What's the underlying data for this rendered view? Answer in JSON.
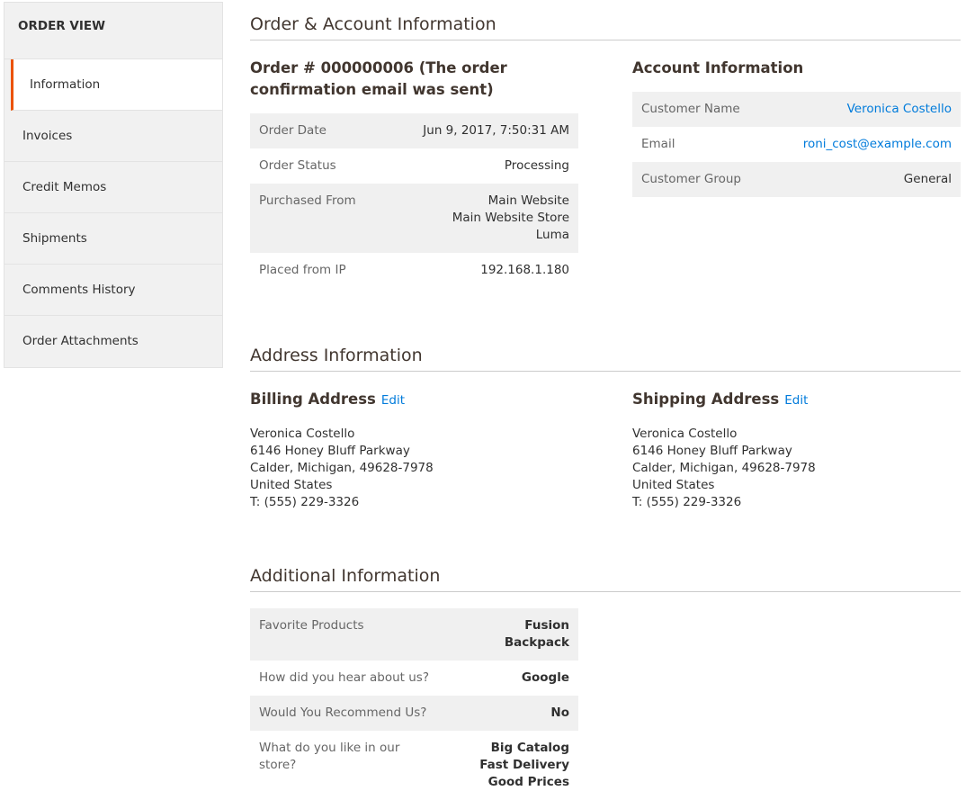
{
  "sidebar": {
    "title": "ORDER VIEW",
    "items": [
      "Information",
      "Invoices",
      "Credit Memos",
      "Shipments",
      "Comments History",
      "Order Attachments"
    ]
  },
  "order_account": {
    "title": "Order & Account Information",
    "order_heading": "Order # 000000006 (The order confirmation email was sent)",
    "order_rows": [
      {
        "label": "Order Date",
        "value": [
          "Jun 9, 2017, 7:50:31 AM"
        ]
      },
      {
        "label": "Order Status",
        "value": [
          "Processing"
        ]
      },
      {
        "label": "Purchased From",
        "value": [
          "Main Website",
          "Main Website Store",
          "Luma"
        ]
      },
      {
        "label": "Placed from IP",
        "value": [
          "192.168.1.180"
        ]
      }
    ],
    "account_heading": "Account Information",
    "account_rows": [
      {
        "label": "Customer Name",
        "value": "Veronica Costello"
      },
      {
        "label": "Email",
        "value": "roni_cost@example.com"
      },
      {
        "label": "Customer Group",
        "value": "General"
      }
    ]
  },
  "address": {
    "title": "Address Information",
    "edit_label": "Edit",
    "billing": {
      "heading": "Billing Address",
      "lines": [
        "Veronica Costello",
        "6146 Honey Bluff Parkway",
        "Calder, Michigan, 49628-7978",
        "United States",
        "T: (555) 229-3326"
      ]
    },
    "shipping": {
      "heading": "Shipping Address",
      "lines": [
        "Veronica Costello",
        "6146 Honey Bluff Parkway",
        "Calder, Michigan, 49628-7978",
        "United States",
        "T: (555) 229-3326"
      ]
    }
  },
  "additional": {
    "title": "Additional Information",
    "rows": [
      {
        "label": "Favorite Products",
        "value": [
          "Fusion Backpack"
        ]
      },
      {
        "label": "How did you hear about us?",
        "value": [
          "Google"
        ]
      },
      {
        "label": "Would You Recommend Us?",
        "value": [
          "No"
        ]
      },
      {
        "label": "What do you like in our store?",
        "value": [
          "Big Catalog",
          "Fast Delivery",
          "Good Prices"
        ]
      }
    ]
  }
}
